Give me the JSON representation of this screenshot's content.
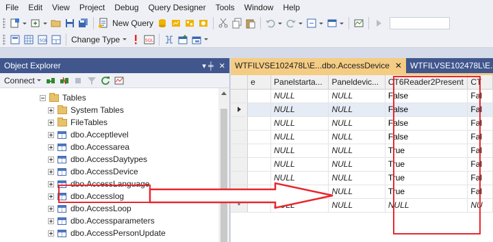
{
  "menu": [
    "File",
    "Edit",
    "View",
    "Project",
    "Debug",
    "Query Designer",
    "Tools",
    "Window",
    "Help"
  ],
  "toolbar1": {
    "new_query_label": "New Query"
  },
  "toolbar2": {
    "change_type_label": "Change Type",
    "dropdown_icon": "chevron-down-icon"
  },
  "object_explorer": {
    "title": "Object Explorer",
    "pin_glyph": "▾ ╪",
    "close_glyph": "✕",
    "connect_label": "Connect",
    "tree": [
      {
        "label": "Tables",
        "level": 0,
        "type": "folder",
        "expanded": true
      },
      {
        "label": "System Tables",
        "level": 1,
        "type": "folder",
        "expanded": false
      },
      {
        "label": "FileTables",
        "level": 1,
        "type": "folder",
        "expanded": false
      },
      {
        "label": "dbo.Acceptlevel",
        "level": 1,
        "type": "table",
        "expanded": false
      },
      {
        "label": "dbo.Accessarea",
        "level": 1,
        "type": "table",
        "expanded": false
      },
      {
        "label": "dbo.AccessDaytypes",
        "level": 1,
        "type": "table",
        "expanded": false
      },
      {
        "label": "dbo.AccessDevice",
        "level": 1,
        "type": "table",
        "expanded": false,
        "highlighted": true
      },
      {
        "label": "dbo.AccessLanguage",
        "level": 1,
        "type": "table",
        "expanded": false
      },
      {
        "label": "dbo.Accesslog",
        "level": 1,
        "type": "table",
        "expanded": false
      },
      {
        "label": "dbo.AccessLoop",
        "level": 1,
        "type": "table",
        "expanded": false
      },
      {
        "label": "dbo.Accessparameters",
        "level": 1,
        "type": "table",
        "expanded": false
      },
      {
        "label": "dbo.AccessPersonUpdate",
        "level": 1,
        "type": "table",
        "expanded": false
      }
    ]
  },
  "tabs": {
    "active": "WTFILVSE102478L\\E...dbo.AccessDevice",
    "close_glyph": "✕",
    "inactive": "WTFILVSE102478L\\E..."
  },
  "grid": {
    "columns": [
      "e",
      "Panelstarta...",
      "Paneldevic...",
      "CT6Reader2Present",
      "CT"
    ],
    "rows": [
      {
        "marker": "",
        "cells": [
          "",
          "NULL",
          "NULL",
          "False",
          "Fal"
        ]
      },
      {
        "marker": "current",
        "cells": [
          "",
          "NULL",
          "NULL",
          "False",
          "Fal"
        ]
      },
      {
        "marker": "",
        "cells": [
          "",
          "NULL",
          "NULL",
          "False",
          "Fal"
        ]
      },
      {
        "marker": "",
        "cells": [
          "",
          "NULL",
          "NULL",
          "False",
          "Fal"
        ]
      },
      {
        "marker": "",
        "cells": [
          "",
          "NULL",
          "NULL",
          "True",
          "Fal"
        ]
      },
      {
        "marker": "",
        "cells": [
          "",
          "NULL",
          "NULL",
          "True",
          "Fal"
        ]
      },
      {
        "marker": "",
        "cells": [
          "",
          "NULL",
          "NULL",
          "True",
          "Fal"
        ]
      },
      {
        "marker": "",
        "cells": [
          "",
          "NULL",
          "NULL",
          "True",
          "Fal"
        ]
      },
      {
        "marker": "new",
        "cells": [
          "",
          "NULL",
          "NULL",
          "NULL",
          "NU"
        ]
      }
    ],
    "new_row_glyph": "*"
  },
  "colors": {
    "accent_title": "#40568d",
    "active_tab": "#f5cc84",
    "annotation": "#e8262b"
  }
}
